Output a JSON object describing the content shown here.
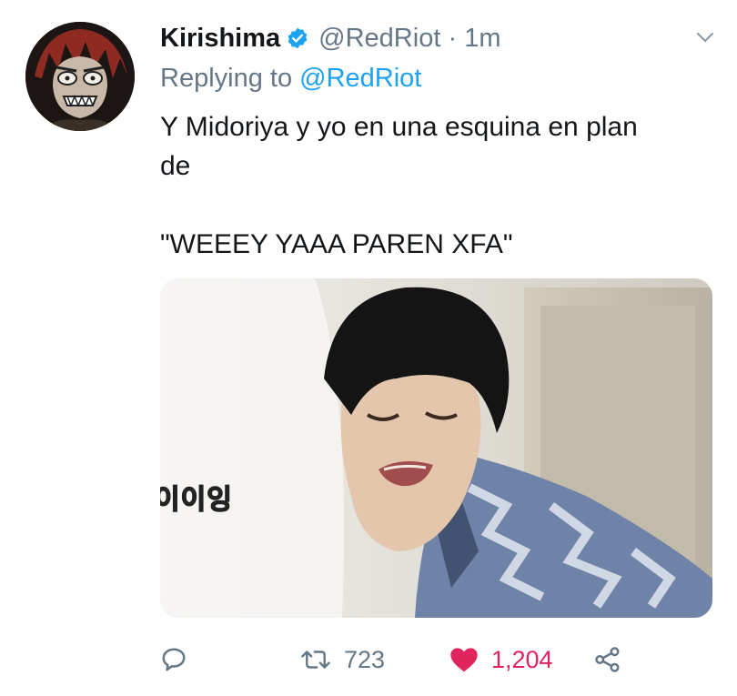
{
  "tweet": {
    "author": {
      "display_name": "Kirishima",
      "verified": true,
      "handle": "@RedRiot",
      "separator": "·",
      "timestamp": "1m"
    },
    "reply": {
      "prefix": "Replying to",
      "mention": "@RedRiot"
    },
    "text": {
      "line1": "Y Midoriya y yo en una esquina en plan",
      "line2": "de",
      "line3": "\"WEEEY YAAA PAREN XFA\""
    },
    "media": {
      "caption_overlay": "이이잉"
    },
    "actions": {
      "reply_count": "",
      "retweet_count": "723",
      "like_count": "1,204",
      "liked": true
    },
    "colors": {
      "accent": "#1da1f2",
      "like": "#e0245e",
      "secondary_text": "#657786"
    }
  }
}
